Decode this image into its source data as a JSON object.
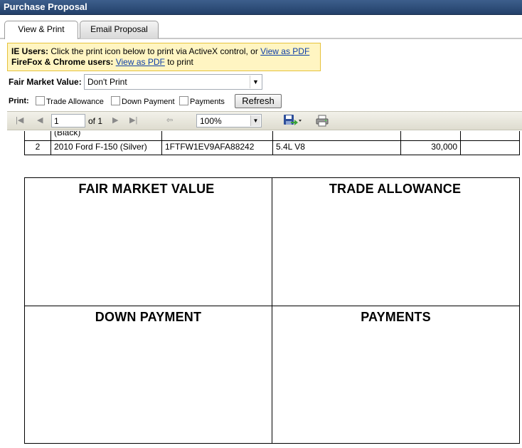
{
  "window": {
    "title": "Purchase Proposal"
  },
  "tabs": [
    {
      "label": "View & Print",
      "active": true
    },
    {
      "label": "Email Proposal",
      "active": false
    }
  ],
  "notice": {
    "ie_prefix": "IE Users:",
    "ie_text": " Click the print icon below to print via ActiveX control, or ",
    "ie_link": "View as PDF",
    "ff_prefix": "FireFox & Chrome users:",
    "ff_link": "View as PDF",
    "ff_suffix": " to print"
  },
  "fmv": {
    "label": "Fair Market Value:",
    "selected": "Don't Print"
  },
  "print_options": {
    "label": "Print:",
    "trade_allowance": "Trade Allowance",
    "down_payment": "Down Payment",
    "payments": "Payments",
    "refresh_label": "Refresh"
  },
  "toolbar": {
    "page_value": "1",
    "of_pages": "of 1",
    "zoom": "100%"
  },
  "vehicles": [
    {
      "num": "",
      "desc": "(Black)",
      "vin": "",
      "engine": "",
      "price": "",
      "extra": ""
    },
    {
      "num": "2",
      "desc": "2010 Ford F-150 (Silver)",
      "vin": "1FTFW1EV9AFA88242",
      "engine": "5.4L V8",
      "price": "30,000",
      "extra": ""
    }
  ],
  "boxes": {
    "fair_market_value": "FAIR MARKET VALUE",
    "trade_allowance": "TRADE ALLOWANCE",
    "down_payment": "DOWN PAYMENT",
    "payments": "PAYMENTS"
  }
}
